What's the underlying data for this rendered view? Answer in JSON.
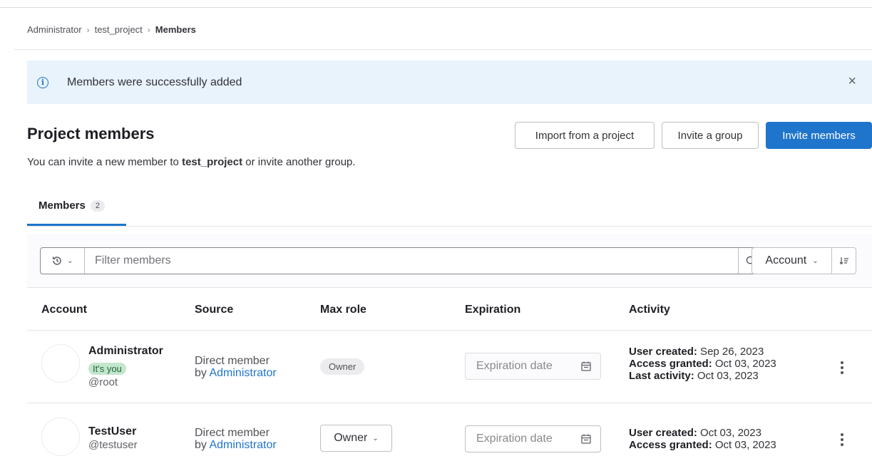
{
  "breadcrumb": {
    "items": [
      "Administrator",
      "test_project"
    ],
    "current": "Members",
    "separator": "›"
  },
  "alert": {
    "message": "Members were successfully added",
    "icon": "info-icon",
    "close": "×"
  },
  "header": {
    "title": "Project members",
    "subtitle_prefix": "You can invite a new member to ",
    "subtitle_project": "test_project",
    "subtitle_suffix": " or invite another group.",
    "buttons": {
      "import": "Import from a project",
      "invite_group": "Invite a group",
      "invite_members": "Invite members"
    }
  },
  "tabs": [
    {
      "label": "Members",
      "count": "2"
    }
  ],
  "filter": {
    "placeholder": "Filter members",
    "sort_label": "Account",
    "icons": {
      "history": "history-icon",
      "search": "search-icon",
      "sort": "sort-direction-icon"
    }
  },
  "table": {
    "columns": [
      "Account",
      "Source",
      "Max role",
      "Expiration",
      "Activity"
    ],
    "rows": [
      {
        "name": "Administrator",
        "badge": "It's you",
        "handle": "@root",
        "source_line1": "Direct member",
        "source_by": "by ",
        "source_link": "Administrator",
        "role": "Owner",
        "expiration_placeholder": "Expiration date",
        "activity": [
          {
            "label": "User created:",
            "value": " Sep 26, 2023"
          },
          {
            "label": "Access granted:",
            "value": " Oct 03, 2023"
          },
          {
            "label": "Last activity:",
            "value": " Oct 03, 2023"
          }
        ]
      },
      {
        "name": "TestUser",
        "handle": "@testuser",
        "source_line1": "Direct member",
        "source_by": "by ",
        "source_link": "Administrator",
        "role": "Owner",
        "expiration_placeholder": "Expiration date",
        "activity": [
          {
            "label": "User created:",
            "value": " Oct 03, 2023"
          },
          {
            "label": "Access granted:",
            "value": " Oct 03, 2023"
          }
        ]
      }
    ]
  },
  "colors": {
    "primary": "#1f75cb",
    "alert_bg": "#e9f3fc",
    "badge_bg": "#c3e6cd",
    "badge_text": "#24663b"
  }
}
